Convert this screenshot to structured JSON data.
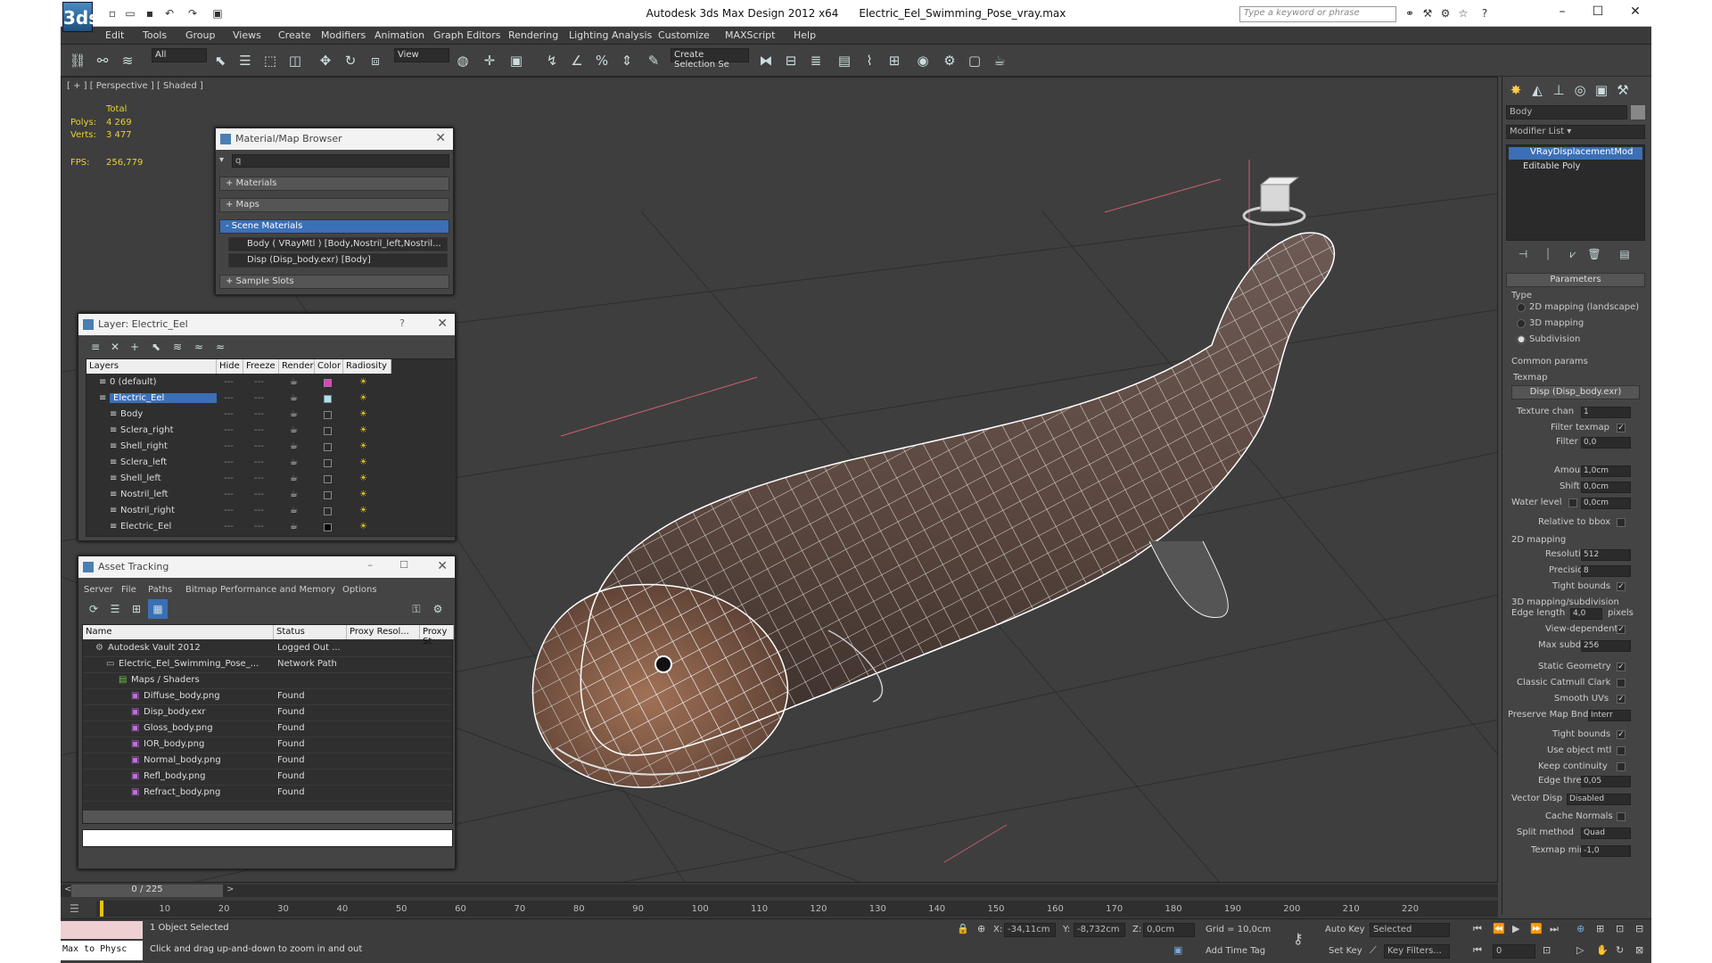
{
  "window": {
    "app_title": "Autodesk 3ds Max Design 2012 x64",
    "file_name": "Electric_Eel_Swimming_Pose_vray.max",
    "search_placeholder": "Type a keyword or phrase",
    "logo_text": "3ds"
  },
  "menu": [
    "Edit",
    "Tools",
    "Group",
    "Views",
    "Create",
    "Modifiers",
    "Animation",
    "Graph Editors",
    "Rendering",
    "Lighting Analysis",
    "Customize",
    "MAXScript",
    "Help"
  ],
  "toolbar": {
    "selection_filter": "All",
    "coord_system": "View",
    "selection_set_placeholder": "Create Selection Se"
  },
  "viewport": {
    "label": "[ + ] [ Perspective ] [ Shaded ]",
    "stats_header": "Total",
    "polys_label": "Polys:",
    "polys_value": "4 269",
    "verts_label": "Verts:",
    "verts_value": "3 477",
    "fps_label": "FPS:",
    "fps_value": "256,779"
  },
  "material_browser": {
    "title": "Material/Map Browser",
    "search_value": "q",
    "rollouts": [
      "+ Materials",
      "+ Maps",
      "- Scene Materials"
    ],
    "items": [
      "Body ( VRayMtl ) [Body,Nostril_left,Nostril...",
      "Disp (Disp_body.exr) [Body]"
    ],
    "sample_slots": "+ Sample Slots"
  },
  "layer_manager": {
    "title": "Layer: Electric_Eel",
    "help": "?",
    "columns": [
      "Layers",
      "Hide",
      "Freeze",
      "Render",
      "Color",
      "Radiosity"
    ],
    "rows": [
      {
        "name": "0 (default)",
        "color": "#e040c0"
      },
      {
        "name": "Electric_Eel",
        "color": "#a8e4f0"
      },
      {
        "name": "Body",
        "color": "#2a2a2a"
      },
      {
        "name": "Sclera_right",
        "color": "#2a2a2a"
      },
      {
        "name": "Shell_right",
        "color": "#2a2a2a"
      },
      {
        "name": "Sclera_left",
        "color": "#2a2a2a"
      },
      {
        "name": "Shell_left",
        "color": "#2a2a2a"
      },
      {
        "name": "Nostril_left",
        "color": "#2a2a2a"
      },
      {
        "name": "Nostril_right",
        "color": "#2a2a2a"
      },
      {
        "name": "Electric_Eel",
        "color": "#000000"
      }
    ]
  },
  "asset_tracking": {
    "title": "Asset Tracking",
    "menu": [
      "Server",
      "File",
      "Paths",
      "Bitmap Performance and Memory",
      "Options"
    ],
    "columns": [
      "Name",
      "Status",
      "Proxy Resol...",
      "Proxy St"
    ],
    "rows": [
      {
        "name": "Autodesk Vault 2012",
        "status": "Logged Out ..."
      },
      {
        "name": "Electric_Eel_Swimming_Pose_...",
        "status": "Network Path"
      },
      {
        "name": "Maps / Shaders",
        "status": ""
      },
      {
        "name": "Diffuse_body.png",
        "status": "Found"
      },
      {
        "name": "Disp_body.exr",
        "status": "Found"
      },
      {
        "name": "Gloss_body.png",
        "status": "Found"
      },
      {
        "name": "IOR_body.png",
        "status": "Found"
      },
      {
        "name": "Normal_body.png",
        "status": "Found"
      },
      {
        "name": "Refl_body.png",
        "status": "Found"
      },
      {
        "name": "Refract_body.png",
        "status": "Found"
      }
    ]
  },
  "command_panel": {
    "object_name": "Body",
    "modifier_list": "Modifier List",
    "stack": [
      "VRayDisplacementMod",
      "Editable Poly"
    ],
    "parameters_title": "Parameters",
    "type_label": "Type",
    "type_options": [
      "2D mapping (landscape)",
      "3D mapping",
      "Subdivision"
    ],
    "common_params": "Common params",
    "texmap_label": "Texmap",
    "texmap_value": "Disp (Disp_body.exr)",
    "texture_chan_label": "Texture chan",
    "texture_chan_value": "1",
    "filter_texmap": "Filter texmap",
    "filter_blur_label": "Filter blur",
    "filter_blur_value": "0,0",
    "amount_label": "Amount",
    "amount_value": "1,0cm",
    "shift_label": "Shift",
    "shift_value": "0,0cm",
    "water_level_label": "Water level",
    "water_level_value": "0,0cm",
    "relative_bbox": "Relative to bbox",
    "mapping2d": "2D mapping",
    "resolution_label": "Resolution",
    "resolution_value": "512",
    "precision_label": "Precision",
    "precision_value": "8",
    "tight_bounds": "Tight bounds",
    "mapping3d": "3D mapping/subdivision",
    "edge_length_label": "Edge length",
    "edge_length_value": "4,0",
    "pixels": "pixels",
    "view_dependent": "View-dependent",
    "max_subdivs_label": "Max subdivs",
    "max_subdivs_value": "256",
    "static_geometry": "Static Geometry",
    "classic_catmull": "Classic Catmull Clark",
    "smooth_uvs": "Smooth UVs",
    "preserve_map_label": "Preserve Map Bnd",
    "preserve_map_value": "Interr",
    "tight_bounds2": "Tight bounds",
    "use_object_mtl": "Use object mtl",
    "keep_continuity": "Keep continuity",
    "edge_thresh_label": "Edge thresh",
    "edge_thresh_value": "0,05",
    "vector_disp_label": "Vector Disp",
    "vector_disp_value": "Disabled",
    "cache_normals": "Cache Normals",
    "split_method_label": "Split method",
    "split_method_value": "Quad",
    "texmap_min_label": "Texmap min",
    "texmap_min_value": "-1,0"
  },
  "timeline": {
    "frame": "0 / 225",
    "ticks": [
      "10",
      "20",
      "30",
      "40",
      "50",
      "60",
      "70",
      "80",
      "90",
      "100",
      "110",
      "120",
      "130",
      "140",
      "150",
      "160",
      "170",
      "180",
      "190",
      "200",
      "210",
      "220"
    ]
  },
  "status": {
    "script_label": "Max to Physc",
    "selected": "1 Object Selected",
    "prompt": "Click and drag up-and-down to zoom in and out",
    "x_label": "X:",
    "x_value": "-34,11cm",
    "y_label": "Y:",
    "y_value": "-8,732cm",
    "z_label": "Z:",
    "z_value": "0,0cm",
    "grid": "Grid = 10,0cm",
    "add_time_tag": "Add Time Tag",
    "auto_key": "Auto Key",
    "set_key": "Set Key",
    "key_mode": "Selected",
    "key_filters": "Key Filters...",
    "frame_value": "0"
  }
}
